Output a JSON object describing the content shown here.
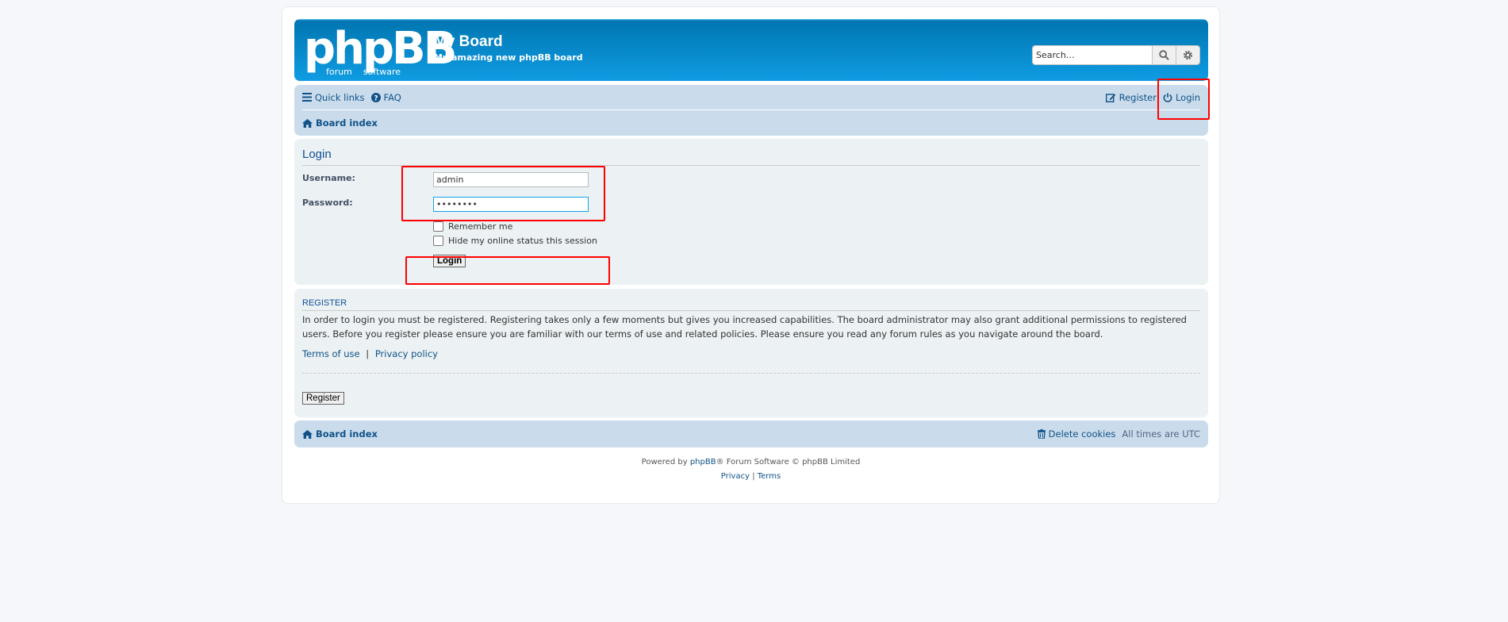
{
  "header": {
    "logo_text": "phpBB",
    "logo_sub_left": "forum",
    "logo_sub_right": "software",
    "site_title": "My Board",
    "site_description": "My amazing new phpBB board",
    "search_placeholder": "Search…"
  },
  "navbar": {
    "quick_links": "Quick links",
    "faq": "FAQ",
    "register": "Register",
    "login": "Login",
    "board_index": "Board index"
  },
  "login_form": {
    "title": "Login",
    "username_label": "Username:",
    "username_value": "admin",
    "password_label": "Password:",
    "password_value": "••••••••",
    "remember_me": "Remember me",
    "hide_online": "Hide my online status this session",
    "submit": "Login"
  },
  "register_panel": {
    "title": "REGISTER",
    "text": "In order to login you must be registered. Registering takes only a few moments but gives you increased capabilities. The board administrator may also grant additional permissions to registered users. Before you register please ensure you are familiar with our terms of use and related policies. Please ensure you read any forum rules as you navigate around the board.",
    "terms_link": "Terms of use",
    "separator": "|",
    "privacy_link": "Privacy policy",
    "register_button": "Register"
  },
  "footer": {
    "board_index": "Board index",
    "delete_cookies": "Delete cookies",
    "timezone": "All times are UTC",
    "powered_prefix": "Powered by ",
    "phpbb_link": "phpBB",
    "powered_suffix": "® Forum Software © phpBB Limited",
    "privacy": "Privacy",
    "separator": "|",
    "terms": "Terms"
  },
  "colors": {
    "header_gradient": "#12a3eb",
    "navbar_bg": "#cadceb",
    "panel_bg": "#ecf1f3",
    "link": "#105289",
    "annotation": "#ff0000"
  }
}
